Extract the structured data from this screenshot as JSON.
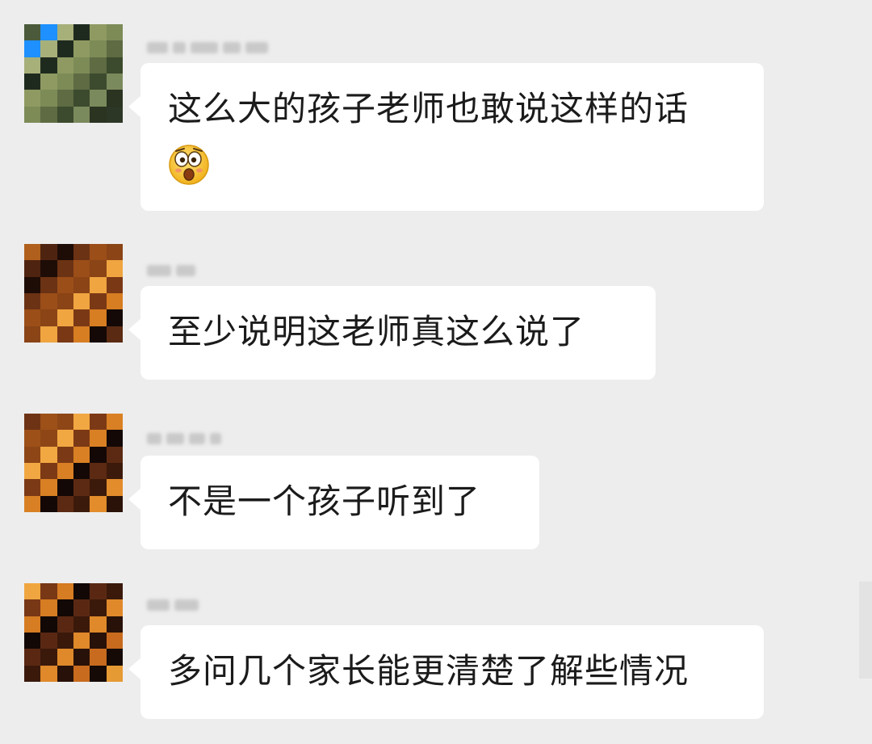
{
  "chat": {
    "messages": [
      {
        "sender_name": "",
        "text": "这么大的孩子老师也敢说这样的话",
        "emoji": "shocked-face-emoji",
        "avatar_palette": [
          "#4a5a3a",
          "#2f8de0",
          "#7b8a5c",
          "#1f2a1e",
          "#c7c27a",
          "#3a4a33",
          "#5e6b43",
          "#1e90ff",
          "#e7d6b8",
          "#2b3321",
          "#8f9a62",
          "#d9b84a",
          "#6f7f4d",
          "#3c4a2d",
          "#a8b07a",
          "#e8c94e",
          "#2c3725",
          "#7d8b57"
        ]
      },
      {
        "sender_name": "",
        "text": "至少说明这老师真这么说了",
        "emoji": "",
        "avatar_palette": [
          "#1a0d08",
          "#5a2a12",
          "#8a4416",
          "#b0601c",
          "#2a1208",
          "#d77d22",
          "#6b3214",
          "#e59a33",
          "#3a1a0b",
          "#f0a540",
          "#4e2410",
          "#c96c1e",
          "#140906",
          "#9b4e18",
          "#2f150a",
          "#e08a2a",
          "#7a3815",
          "#1e0c06"
        ]
      },
      {
        "sender_name": "",
        "text": "不是一个孩子听到了",
        "emoji": "",
        "avatar_palette": [
          "#160a06",
          "#5c2a12",
          "#8e4616",
          "#b4621d",
          "#2a1208",
          "#d98024",
          "#6e3314",
          "#e89e36",
          "#3c1a0b",
          "#f2a842",
          "#502510",
          "#cb6e1f",
          "#130806",
          "#9d5018",
          "#30160a",
          "#e28c2b",
          "#7c3915",
          "#1f0d07"
        ]
      },
      {
        "sender_name": "",
        "text": "多问几个家长能更清楚了解些情况",
        "emoji": "",
        "avatar_palette": [
          "#150a06",
          "#5a2812",
          "#8c4416",
          "#b2601c",
          "#281108",
          "#d67c22",
          "#6a3114",
          "#e69a33",
          "#3a190b",
          "#f0a640",
          "#4c2310",
          "#c86b1e",
          "#120806",
          "#9a4d18",
          "#2e140a",
          "#df892a",
          "#783715",
          "#1d0c06"
        ]
      }
    ]
  }
}
